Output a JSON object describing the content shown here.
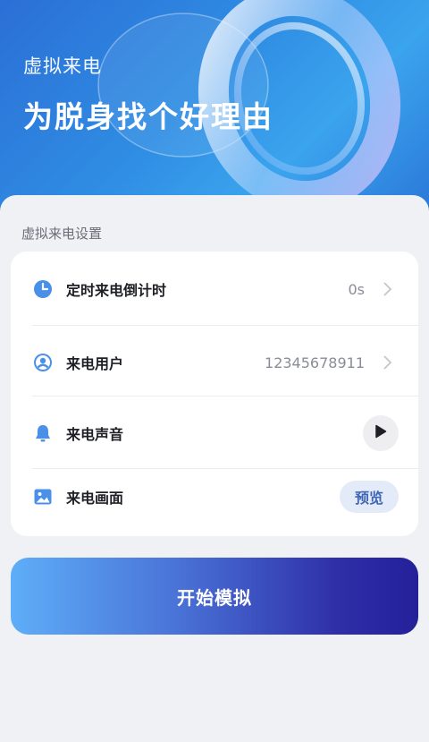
{
  "header": {
    "subtitle": "虚拟来电",
    "title": "为脱身找个好理由"
  },
  "settings": {
    "section_label": "虚拟来电设置",
    "rows": [
      {
        "label": "定时来电倒计时",
        "value": "0s",
        "icon": "clock-icon"
      },
      {
        "label": "来电用户",
        "value": "12345678911",
        "icon": "user-avatar-icon"
      },
      {
        "label": "来电声音",
        "icon": "bell-icon",
        "action_icon": "play-icon"
      },
      {
        "label": "来电画面",
        "icon": "image-icon",
        "action_label": "预览"
      }
    ]
  },
  "actions": {
    "start_label": "开始模拟"
  },
  "colors": {
    "accent": "#4a8fe8",
    "start_gradient_from": "#5eaef8",
    "start_gradient_to": "#23209a",
    "preview_bg": "#e3ebf8"
  }
}
